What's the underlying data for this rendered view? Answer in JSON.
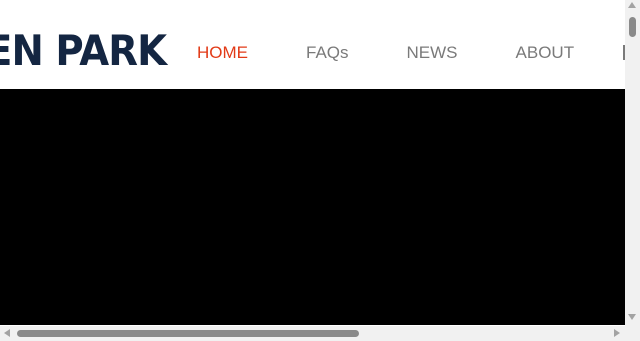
{
  "header": {
    "logo_text": "EN PARK",
    "nav": [
      {
        "label": "HOME",
        "active": true
      },
      {
        "label": "FAQs",
        "active": false
      },
      {
        "label": "NEWS",
        "active": false
      },
      {
        "label": "ABOUT",
        "active": false
      }
    ]
  },
  "colors": {
    "logo": "#142642",
    "nav_active": "#e23a17",
    "nav_default": "#7a7a7a",
    "video_bg": "#000000"
  },
  "scroll": {
    "horizontal_thumb_fraction": 0.55,
    "vertical_thumb_fraction": 0.06
  }
}
